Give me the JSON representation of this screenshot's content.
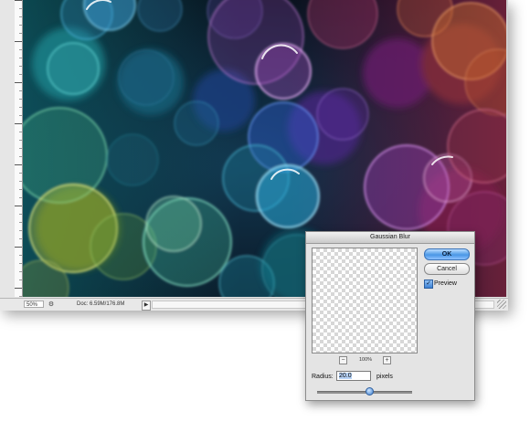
{
  "status_bar": {
    "zoom": "50%",
    "doc_info": "Doc: 6.59M/176.8M"
  },
  "dialog": {
    "title": "Gaussian Blur",
    "ok_label": "OK",
    "cancel_label": "Cancel",
    "preview_label": "Preview",
    "preview_checked": true,
    "zoom_level": "100%",
    "zoom_out_glyph": "−",
    "zoom_in_glyph": "+",
    "radius_label": "Radius:",
    "radius_value": "20.0",
    "radius_units": "pixels",
    "radius_slider_fraction": 0.55
  },
  "icons": {
    "status_icon": "gear-icon",
    "arrow": "triangle-right-icon",
    "check": "checkmark-icon"
  }
}
